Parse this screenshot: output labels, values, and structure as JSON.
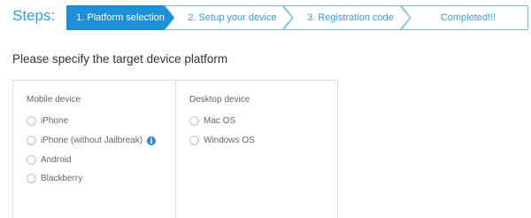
{
  "wizard": {
    "title": "Steps:",
    "steps": [
      {
        "label": "1. Platform selection",
        "state": "active"
      },
      {
        "label": "2. Setup your device",
        "state": "pending"
      },
      {
        "label": "3. Registration code",
        "state": "pending"
      },
      {
        "label": "Completed!!!",
        "state": "pending"
      }
    ]
  },
  "page": {
    "title": "Please specify the target device platform"
  },
  "mobile": {
    "heading": "Mobile device",
    "options": [
      {
        "label": "iPhone",
        "selected": false
      },
      {
        "label": "iPhone (without Jailbreak)",
        "selected": false,
        "icon": "info-icon"
      },
      {
        "label": "Android",
        "selected": false
      },
      {
        "label": "Blackberry",
        "selected": false
      }
    ]
  },
  "desktop": {
    "heading": "Desktop device",
    "options": [
      {
        "label": "Mac OS",
        "selected": false
      },
      {
        "label": "Windows OS",
        "selected": false
      }
    ]
  },
  "colors": {
    "accent": "#29a3e0",
    "active_step": "#1f8fd6",
    "border": "#dcdcdc"
  }
}
